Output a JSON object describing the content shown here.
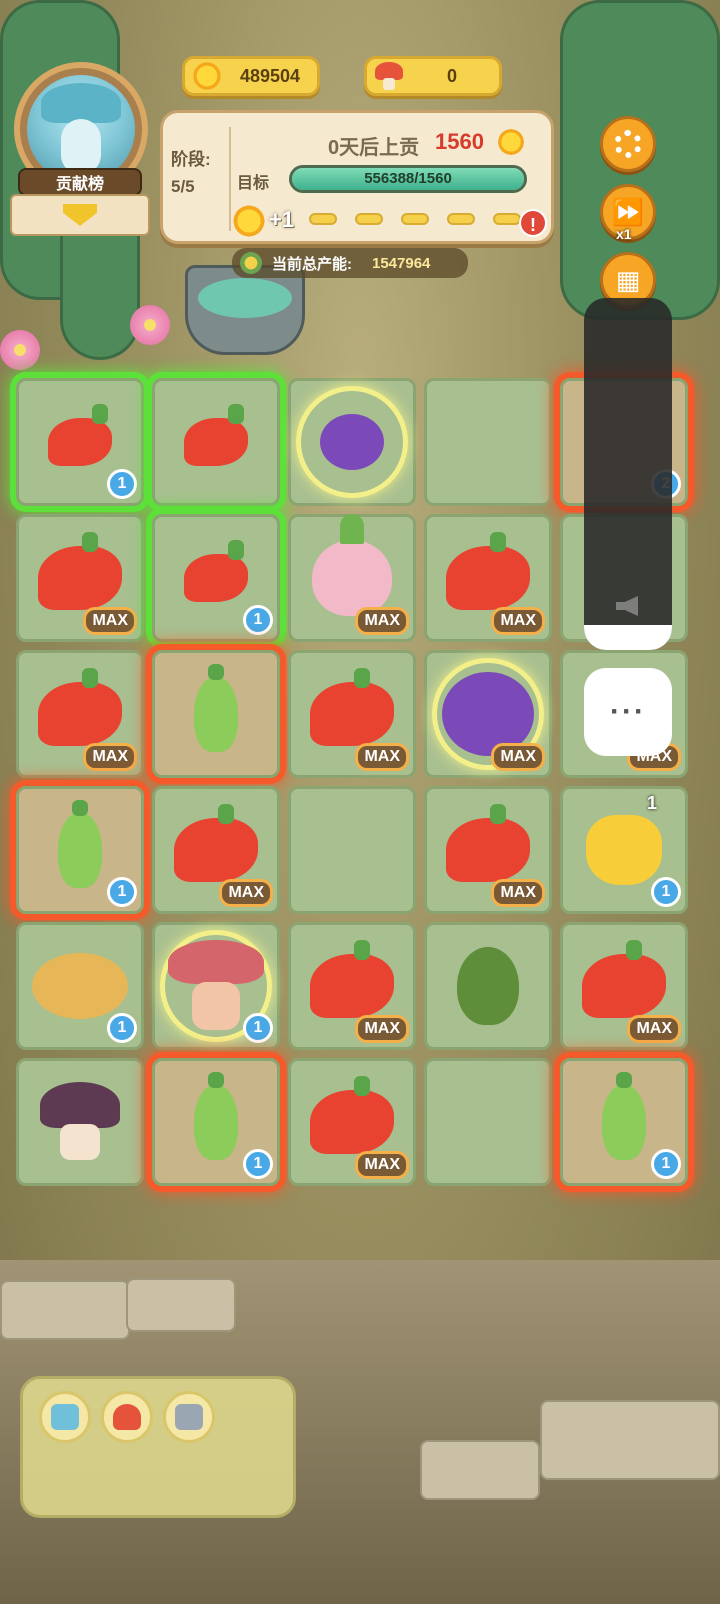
{
  "leaderboard": {
    "label": "贡献榜"
  },
  "currency": {
    "sun": "489504",
    "mushroom": "0"
  },
  "stage": {
    "label": "阶段:",
    "value": "5/5",
    "due_text": "0天后上贡",
    "due_amount": "1560",
    "target_label": "目标",
    "progress_text": "556388/1560",
    "progress_fraction": 1.0,
    "bonus_text": "+1",
    "alert_symbol": "!"
  },
  "output": {
    "label": "当前总产能:",
    "value": "1547964"
  },
  "side_buttons": {
    "speed_label": "x1"
  },
  "overlay": {
    "more_label": "···",
    "volume_level_fraction": 0.07
  },
  "grid": {
    "cells": [
      {
        "veg": "small-red-pepper",
        "badge": "1",
        "glow": "green"
      },
      {
        "veg": "small-red-pepper",
        "badge": "",
        "glow": "green"
      },
      {
        "veg": "eggplant",
        "badge": "",
        "glow": "none"
      },
      {
        "veg": "empty",
        "badge": "",
        "glow": "none"
      },
      {
        "veg": "unknown",
        "badge": "2",
        "glow": "red"
      },
      {
        "veg": "red-pepper",
        "badge": "MAX",
        "glow": "none"
      },
      {
        "veg": "small-red-pepper",
        "badge": "1",
        "glow": "green"
      },
      {
        "veg": "onion",
        "badge": "MAX",
        "glow": "none"
      },
      {
        "veg": "red-pepper",
        "badge": "MAX",
        "glow": "none"
      },
      {
        "veg": "unknown",
        "badge": "",
        "glow": "none"
      },
      {
        "veg": "red-pepper",
        "badge": "MAX",
        "glow": "none"
      },
      {
        "veg": "green-chili",
        "badge": "",
        "glow": "red"
      },
      {
        "veg": "red-pepper",
        "badge": "MAX",
        "glow": "none"
      },
      {
        "veg": "big-eggplant",
        "badge": "MAX",
        "glow": "none"
      },
      {
        "veg": "unknown",
        "badge": "MAX",
        "glow": "none"
      },
      {
        "veg": "green-chili",
        "badge": "1",
        "glow": "red"
      },
      {
        "veg": "red-pepper",
        "badge": "MAX",
        "glow": "none"
      },
      {
        "veg": "empty",
        "badge": "",
        "glow": "none"
      },
      {
        "veg": "red-pepper",
        "badge": "MAX",
        "glow": "none"
      },
      {
        "veg": "bell-pepper",
        "badge": "1",
        "glow": "none",
        "float": "1"
      },
      {
        "veg": "potato",
        "badge": "1",
        "glow": "none"
      },
      {
        "veg": "red-mushroom",
        "badge": "1",
        "glow": "none"
      },
      {
        "veg": "red-pepper",
        "badge": "MAX",
        "glow": "none"
      },
      {
        "veg": "avocado",
        "badge": "",
        "glow": "none"
      },
      {
        "veg": "red-pepper",
        "badge": "MAX",
        "glow": "none"
      },
      {
        "veg": "purple-mushroom",
        "badge": "",
        "glow": "none"
      },
      {
        "veg": "green-chili",
        "badge": "1",
        "glow": "red"
      },
      {
        "veg": "red-pepper",
        "badge": "MAX",
        "glow": "none"
      },
      {
        "veg": "empty",
        "badge": "",
        "glow": "none"
      },
      {
        "veg": "green-chili",
        "badge": "1",
        "glow": "red"
      }
    ]
  },
  "tools": [
    "map-icon",
    "shop-icon",
    "handshake-icon"
  ],
  "colors": {
    "accent": "#f6a524",
    "max_glow": "#5de13a",
    "alert_glow": "#f55a2a",
    "progress": "#3fb08d"
  }
}
